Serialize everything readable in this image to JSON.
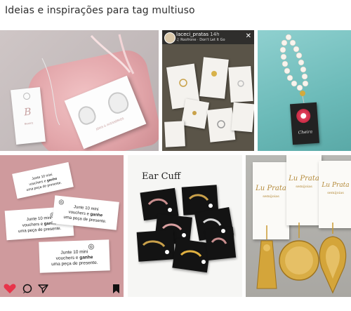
{
  "page": {
    "title": "Ideias e inspirações para tag multiuso"
  },
  "tiles": {
    "bag": {
      "tag_brand": "Beatriz",
      "card_brand": "JOIAS & ACESSÓRIOS"
    },
    "story": {
      "username": "laceci_pratas",
      "time": "14h",
      "song": "♫ Roofrone · Don't Let It Go"
    },
    "bracelet": {
      "tag_brand": "Cheira"
    },
    "vouchers": {
      "line1": "Junte 10 mini",
      "line2a": "vouchers e ",
      "line2b": "ganhe",
      "line3": "uma peça de presente."
    },
    "earcuff": {
      "title": "Ear Cuff"
    },
    "pendants": {
      "brand": "Lu Prata",
      "sub": "semijoias"
    }
  },
  "colors": {
    "bag_pink": "#e3a7ab",
    "teal_cloth": "#6bbab8",
    "voucher_bg": "#cf9a9d",
    "like_red": "#e8344a",
    "gold": "#c99a32"
  },
  "icons": [
    "heart-icon",
    "comment-icon",
    "share-icon",
    "bookmark-icon",
    "close-icon",
    "ring-icon"
  ]
}
